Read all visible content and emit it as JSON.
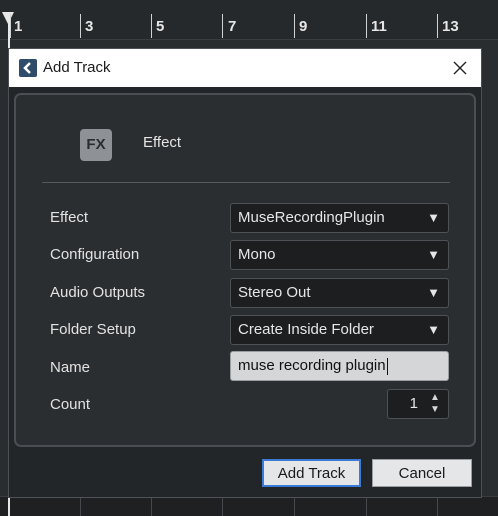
{
  "ruler": {
    "markers": [
      "1",
      "3",
      "5",
      "7",
      "9",
      "11",
      "13"
    ]
  },
  "dialog": {
    "title": "Add Track",
    "close_icon": "close-icon",
    "track_type": {
      "badge": "FX",
      "label": "Effect"
    },
    "fields": {
      "effect": {
        "label": "Effect",
        "value": "MuseRecordingPlugin"
      },
      "configuration": {
        "label": "Configuration",
        "value": "Mono"
      },
      "audio_outputs": {
        "label": "Audio Outputs",
        "value": "Stereo Out"
      },
      "folder_setup": {
        "label": "Folder Setup",
        "value": "Create Inside Folder"
      },
      "name": {
        "label": "Name",
        "value": "muse recording plugin"
      },
      "count": {
        "label": "Count",
        "value": "1"
      }
    },
    "buttons": {
      "add_track": "Add Track",
      "cancel": "Cancel"
    }
  },
  "colors": {
    "accent": "#3a7bd5",
    "dialog_bg": "#232628",
    "panel_bg": "#2b2e31"
  }
}
